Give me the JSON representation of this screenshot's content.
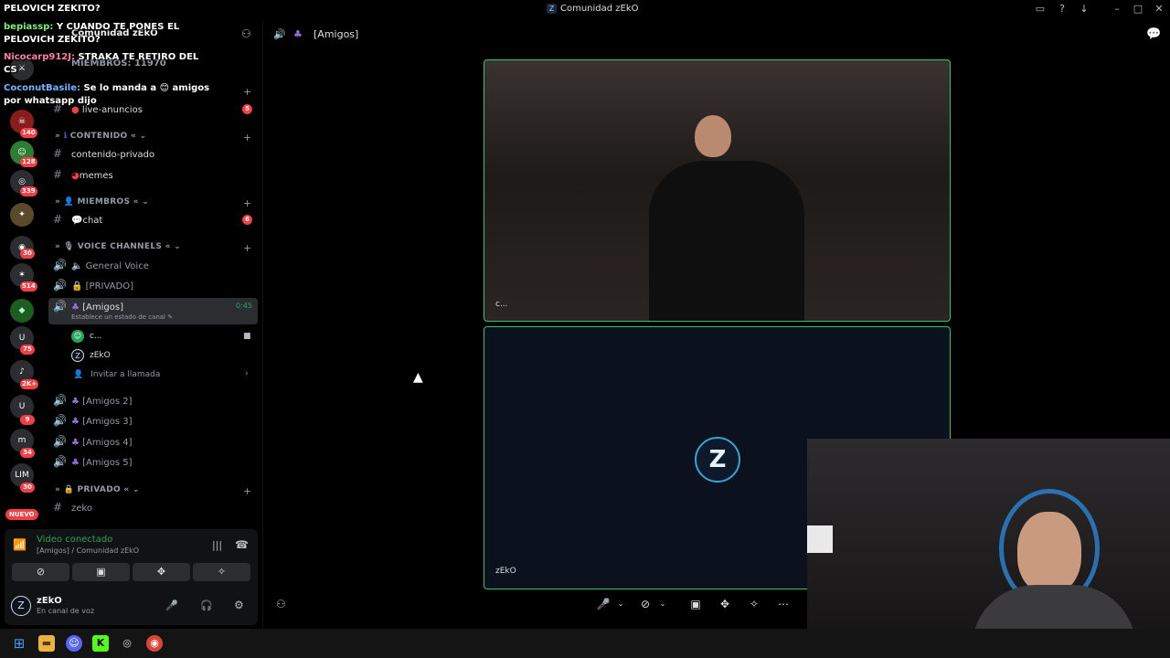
{
  "window": {
    "title": "Comunidad zEkO"
  },
  "server": {
    "name": "Comunidad zEkO",
    "member_count": "MIEMBROS: 11970"
  },
  "chat_overlay": [
    {
      "user": "",
      "msg": "PELOVICH ZEKITO?",
      "user_color": "#ffffff"
    },
    {
      "user": "bepiassp:",
      "msg": "Y CUANDO TE PONES EL",
      "user_color": "#7ef07a"
    },
    {
      "user": "",
      "msg": "PELOVICH ZEKITO?",
      "user_color": "#ffffff"
    },
    {
      "user": "Nicocarp912J:",
      "msg": "STRAKA TE RETIRO DEL",
      "user_color": "#ff7aa8"
    },
    {
      "user": "",
      "msg": "CS",
      "user_color": "#ffffff"
    },
    {
      "user": "CoconutBasile:",
      "msg": "Se lo manda a 😊 amigos",
      "user_color": "#6fb6ff"
    },
    {
      "user": "",
      "msg": "por whatsapp dijo",
      "user_color": "#ffffff"
    }
  ],
  "channels": {
    "live": {
      "name": "live-anuncios",
      "badge": "5"
    },
    "cat_contenido": "CONTENIDO",
    "contenido_privado": "contenido-privado",
    "memes": "memes",
    "cat_miembros": "MIEMBROS",
    "chat": {
      "name": "chat",
      "badge": "6"
    },
    "cat_voice": "VOICE CHANNELS",
    "general_voice": "General Voice",
    "privado_voice": "[PRIVADO]",
    "amigos": {
      "name": "[Amigos]",
      "timer": "0:45",
      "status_hint": "Establece un estado de canal"
    },
    "voice_users": [
      {
        "name": "c..."
      },
      {
        "name": "zEkO"
      }
    ],
    "invite": "Invitar a llamada",
    "amigos2": "[Amigos 2]",
    "amigos3": "[Amigos 3]",
    "amigos4": "[Amigos 4]",
    "amigos5": "[Amigos 5]",
    "cat_privado": "PRIVADO",
    "zeko": "zeko"
  },
  "guild_badges": [
    "140",
    "128",
    "339",
    "30",
    "514",
    "75",
    "2K+",
    "9",
    "34",
    "30"
  ],
  "nuevo_label": "NUEVO",
  "voice_panel": {
    "status": "Video conectado",
    "location": "[Amigos] / Comunidad zEkO"
  },
  "user_panel": {
    "name": "zEkO",
    "status": "En canal de voz"
  },
  "call": {
    "channel_title": "[Amigos]",
    "tile1_label": "c...",
    "tile2_label": "zEkO"
  },
  "colors": {
    "accent_green": "#23a55a",
    "badge_red": "#f23f43",
    "tile_border": "#2dc770"
  }
}
